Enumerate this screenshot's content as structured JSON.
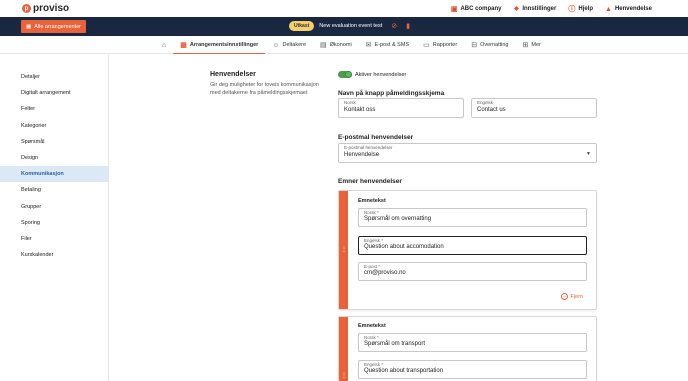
{
  "brand": {
    "name": "proviso",
    "mark": "p"
  },
  "top_links": [
    {
      "icon": "briefcase",
      "label": "ABC company"
    },
    {
      "icon": "gear",
      "label": "Innstillinger"
    },
    {
      "icon": "help",
      "label": "Hjelp"
    },
    {
      "icon": "bell",
      "label": "Henvendelse"
    }
  ],
  "eventbar": {
    "all_button": "Alle arrangementer",
    "status_badge": "Utkast",
    "event_name": "New evaluation event test",
    "icon_link": "link-icon",
    "icon_stats": "stats-icon"
  },
  "nav": {
    "items": [
      {
        "label": "",
        "icon": "home"
      },
      {
        "label": "Arrangementsinnstillinger",
        "icon": "calendar",
        "active": true
      },
      {
        "label": "Deltakere",
        "icon": "users"
      },
      {
        "label": "Økonomi",
        "icon": "wallet"
      },
      {
        "label": "E-post & SMS",
        "icon": "mail"
      },
      {
        "label": "Rapporter",
        "icon": "report"
      },
      {
        "label": "Overnatting",
        "icon": "bed"
      },
      {
        "label": "Mer",
        "icon": "grid"
      }
    ]
  },
  "sidebar": {
    "items": [
      {
        "label": "Detaljer"
      },
      {
        "label": "Digitalt arrangement"
      },
      {
        "label": "Felter"
      },
      {
        "label": "Kategorier"
      },
      {
        "label": "Spørsmål"
      },
      {
        "label": "Design"
      },
      {
        "label": "Kommunikasjon",
        "active": true
      },
      {
        "label": "Betaling"
      },
      {
        "label": "Grupper"
      },
      {
        "label": "Sporing"
      },
      {
        "label": "Filer"
      },
      {
        "label": "Kurskalender"
      }
    ]
  },
  "section": {
    "title": "Henvendelser",
    "description": "Gir deg muligheter for toveis kommunikasjon med deltakerne fra påmeldingsskjemaet"
  },
  "toggle": {
    "label": "Aktiver henvendelser",
    "on": true
  },
  "button_name": {
    "heading": "Navn på knapp påmeldingsskjema",
    "norsk_label": "Norsk",
    "norsk_value": "Kontakt oss",
    "english_label": "Engelsk",
    "english_value": "Contact us"
  },
  "email_section": {
    "heading": "E-postmal henvendelser",
    "select_label": "E-postmal henvendelser",
    "select_value": "Henvendelse"
  },
  "subjects": {
    "heading": "Emner henvendelser",
    "cards": [
      {
        "title": "Emnetekst",
        "norsk_label": "Norsk *",
        "norsk_value": "Spørsmål om overnatting",
        "english_label": "Engelsk *",
        "english_value": "Question about accomodation",
        "email_label": "E-post *",
        "email_value": "cm@proviso.no",
        "remove_label": "Fjern"
      },
      {
        "title": "Emnetekst",
        "norsk_label": "Norsk *",
        "norsk_value": "Spørsmål om transport",
        "english_label": "Engelsk *",
        "english_value": "Question about transportation"
      }
    ]
  },
  "colors": {
    "accent": "#e8623a",
    "dark": "#1a2740",
    "active_bg": "#dbe8f6",
    "toggle": "#4a9d4a"
  }
}
